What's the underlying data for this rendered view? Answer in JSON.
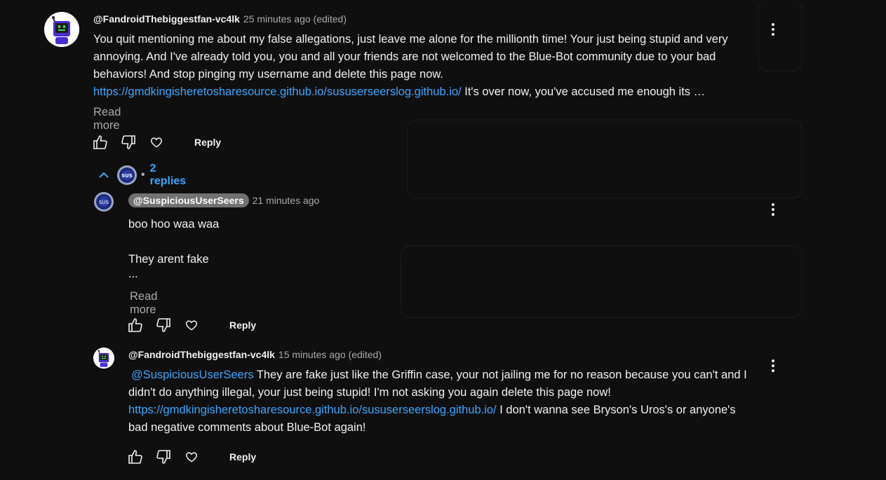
{
  "comments": [
    {
      "author": "@FandroidThebiggestfan-vc4lk",
      "time": "25 minutes ago (edited)",
      "text_before_link": "You quit mentioning me about my false allegations, just leave me alone for the millionth time! Your just being stupid and very annoying. And I've already told you, you and all your friends are not welcomed to the Blue-Bot community due to your bad behaviors! And stop pinging my username and delete this page now.",
      "link": "https://gmdkingisheretosharesource.github.io/sususerseerslog.github.io/",
      "text_after_link": " It's over now, you've accused me enough its …",
      "read_more": "Read more",
      "reply_label": "Reply",
      "replies_label": "2 replies",
      "avatar_icon": "robot-avatar-icon"
    }
  ],
  "replies": [
    {
      "author": "@SuspiciousUserSeers",
      "time": "21 minutes ago",
      "line1": "boo hoo waa waa",
      "line2": "They arent fake",
      "line3": "...",
      "read_more": "Read more",
      "reply_label": "Reply",
      "avatar_icon": "seal-avatar-icon"
    },
    {
      "author": "@FandroidThebiggestfan-vc4lk",
      "time": "15 minutes ago (edited)",
      "mention": "@SuspiciousUserSeers",
      "text_before_link": "  They are fake just like the Griffin case, your not jailing me for no reason because you can't and I didn't do anything illegal, your just being stupid! I'm not asking you again delete this page now!",
      "link": "https://gmdkingisheretosharesource.github.io/sususerseerslog.github.io/",
      "text_after_link": " I don't wanna see Bryson's Uros's or anyone's bad negative comments about Blue-Bot again!",
      "reply_label": "Reply",
      "avatar_icon": "robot-avatar-icon"
    }
  ],
  "colors": {
    "background": "#0f0f0f",
    "link": "#3ea6ff",
    "meta": "#aaaaaa",
    "robot_face": "#4a2fd0",
    "robot_screen": "#1d1d1d",
    "robot_eyes": "#3fe04a"
  }
}
